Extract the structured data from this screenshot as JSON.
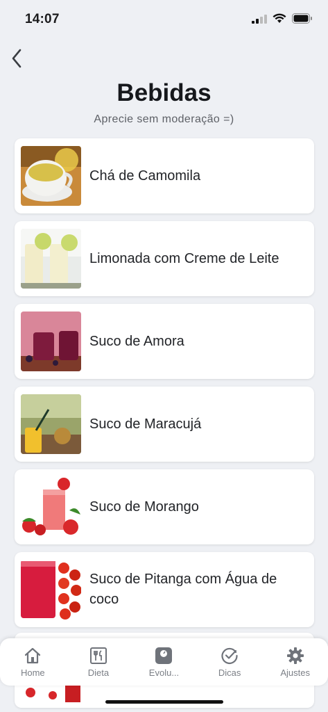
{
  "status": {
    "time": "14:07"
  },
  "header": {
    "title": "Bebidas",
    "subtitle": "Aprecie sem moderação =)"
  },
  "drinks": [
    {
      "label": "Chá de Camomila"
    },
    {
      "label": "Limonada com Creme de Leite"
    },
    {
      "label": "Suco de Amora"
    },
    {
      "label": "Suco de Maracujá"
    },
    {
      "label": "Suco de Morango"
    },
    {
      "label": "Suco de Pitanga com  Água de coco"
    }
  ],
  "tabs": [
    {
      "label": "Home",
      "icon": "home-icon"
    },
    {
      "label": "Dieta",
      "icon": "diet-icon"
    },
    {
      "label": "Evolu...",
      "icon": "scale-icon"
    },
    {
      "label": "Dicas",
      "icon": "check-circle-icon"
    },
    {
      "label": "Ajustes",
      "icon": "gear-icon"
    }
  ]
}
